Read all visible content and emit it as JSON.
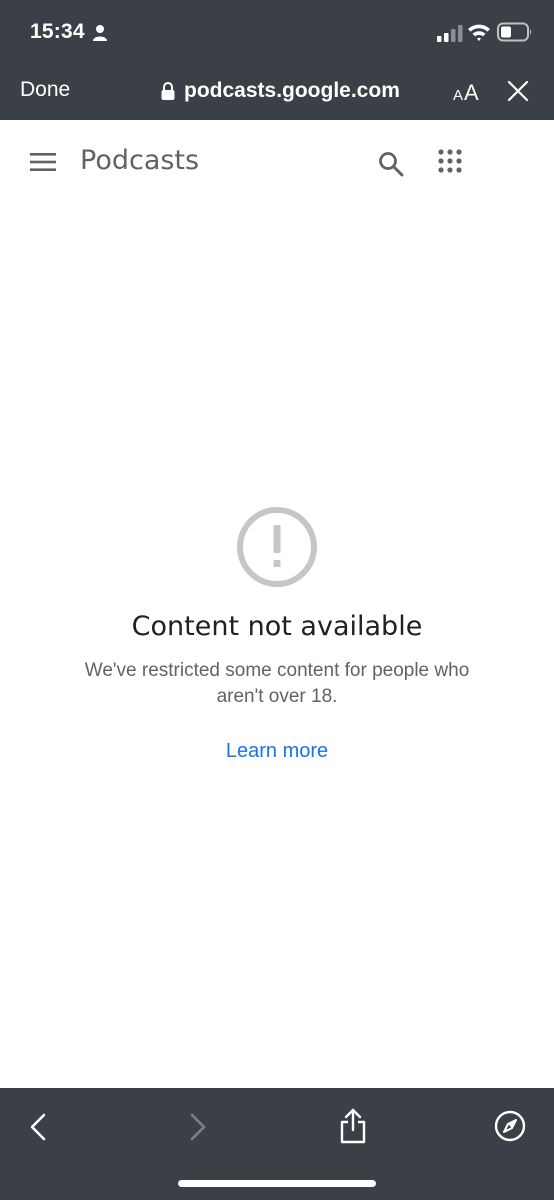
{
  "status_bar": {
    "time": "15:34",
    "icons": [
      "person-icon",
      "signal-icon",
      "wifi-icon",
      "battery-icon"
    ]
  },
  "browser": {
    "done_label": "Done",
    "url": "podcasts.google.com",
    "text_size_label": "AA",
    "icons": [
      "lock-icon",
      "close-icon"
    ]
  },
  "app_header": {
    "title": "Podcasts",
    "icons": [
      "menu-icon",
      "search-icon",
      "apps-icon"
    ]
  },
  "message": {
    "icon": "alert-circle-icon",
    "title": "Content not available",
    "body": "We've restricted some content for people who aren't over 18.",
    "link": "Learn more"
  },
  "toolbar": {
    "icons": [
      "back-icon",
      "forward-icon",
      "share-icon",
      "compass-icon"
    ]
  },
  "colors": {
    "chrome": "#3b3f46",
    "link": "#1a73e8",
    "muted_text": "#5f6368",
    "title_text": "#202124",
    "icon_gray": "#c4c6ca"
  }
}
